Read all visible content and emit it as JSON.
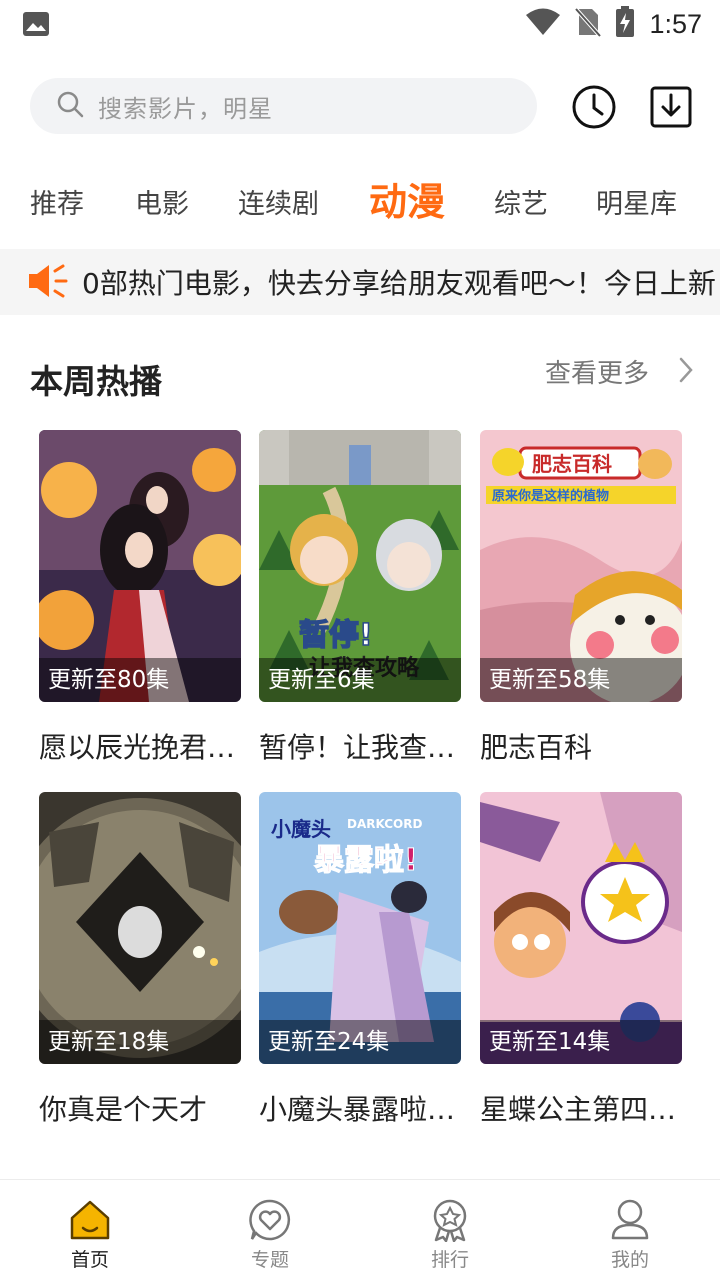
{
  "status_bar": {
    "time": "1:57"
  },
  "search": {
    "placeholder": "搜索影片，明星"
  },
  "tabs": [
    {
      "label": "推荐"
    },
    {
      "label": "电影"
    },
    {
      "label": "连续剧"
    },
    {
      "label": "动漫",
      "active": true
    },
    {
      "label": "综艺"
    },
    {
      "label": "明星库"
    }
  ],
  "notice": {
    "text": "0部热门电影，快去分享给朋友观看吧～！今日上新"
  },
  "section": {
    "title": "本周热播",
    "more_label": "查看更多"
  },
  "cards": [
    {
      "title": "愿以辰光挽君…",
      "episode": "更新至80集"
    },
    {
      "title": "暂停！让我查…",
      "episode": "更新至6集"
    },
    {
      "title": "肥志百科",
      "episode": "更新至58集"
    },
    {
      "title": "你真是个天才",
      "episode": "更新至18集"
    },
    {
      "title": "小魔头暴露啦…",
      "episode": "更新至24集"
    },
    {
      "title": "星蝶公主第四…",
      "episode": "更新至14集"
    }
  ],
  "posters": {
    "p2_logo": "暂停!",
    "p2_sub": "让我查攻略",
    "p3_logo": "肥志百科",
    "p3_sub": "原来你是这样的植物",
    "p5_logo": "小魔头",
    "p5_sub": "暴露啦!",
    "p5_en": "DARKCORD"
  },
  "bottom_nav": [
    {
      "label": "首页",
      "icon": "home-icon",
      "active": true
    },
    {
      "label": "专题",
      "icon": "heart-chat-icon"
    },
    {
      "label": "排行",
      "icon": "medal-icon"
    },
    {
      "label": "我的",
      "icon": "user-icon"
    }
  ],
  "colors": {
    "accent": "#ff6a12",
    "nav_active": "#f5b400"
  }
}
